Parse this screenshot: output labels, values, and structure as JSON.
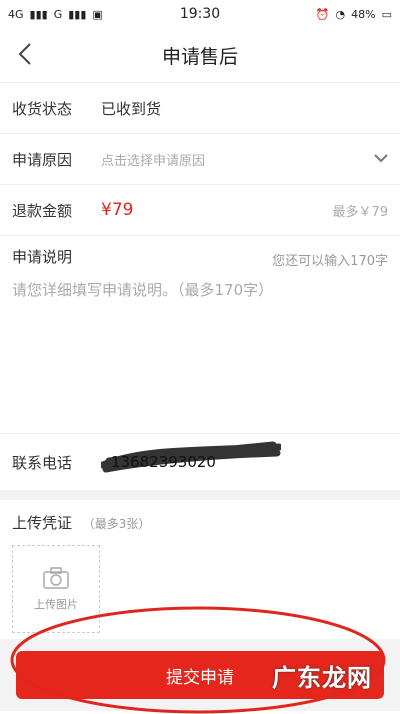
{
  "statusbar": {
    "network_left": "4G",
    "signal_text": "G",
    "time": "19:30",
    "battery": "48%"
  },
  "header": {
    "title": "申请售后"
  },
  "form": {
    "receipt_label": "收货状态",
    "receipt_value": "已收到货",
    "reason_label": "申请原因",
    "reason_placeholder": "点击选择申请原因",
    "refund_label": "退款金额",
    "refund_value": "¥79",
    "refund_max": "最多￥79",
    "remark_label": "申请说明",
    "remark_counter": "您还可以输入170字",
    "remark_placeholder": "请您详细填写申请说明。（最多170字）",
    "phone_label": "联系电话",
    "phone_value": "13682393020"
  },
  "upload": {
    "title": "上传凭证",
    "limit": "（最多3张）",
    "button_label": "上传图片"
  },
  "actions": {
    "submit_label": "提交申请"
  },
  "watermark": "广东龙网",
  "colors": {
    "accent": "#e4261c",
    "text": "#333333",
    "hint": "#aaaaaa"
  },
  "icons": [
    "back-arrow-icon",
    "chevron-down-icon",
    "camera-icon",
    "alarm-icon",
    "wifi-icon",
    "battery-icon"
  ]
}
